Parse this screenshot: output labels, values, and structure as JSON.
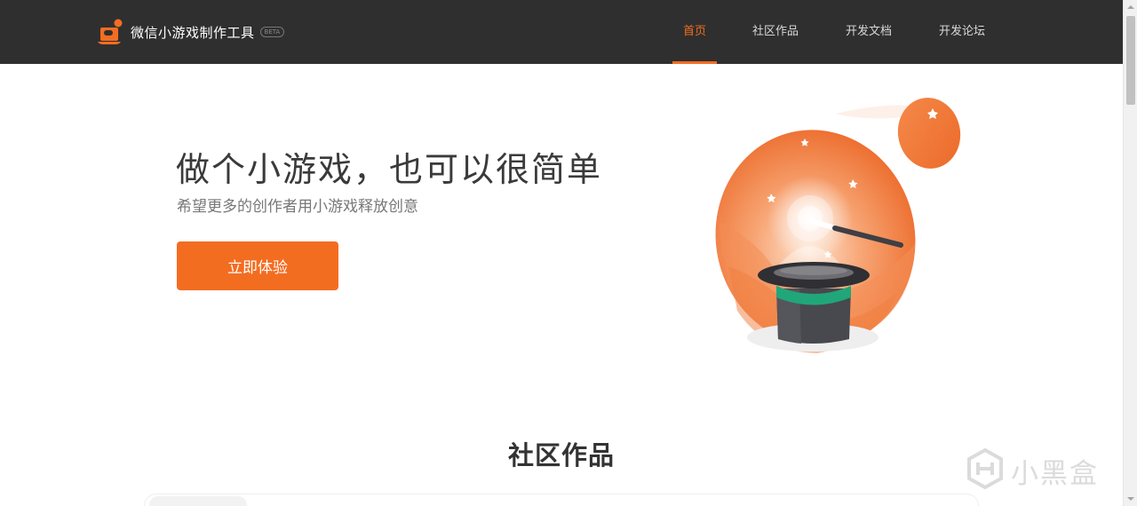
{
  "header": {
    "logo_text": "微信小游戏制作工具",
    "beta_label": "BETA",
    "nav": [
      {
        "label": "首页",
        "active": true
      },
      {
        "label": "社区作品",
        "active": false
      },
      {
        "label": "开发文档",
        "active": false
      },
      {
        "label": "开发论坛",
        "active": false
      }
    ]
  },
  "hero": {
    "title": "做个小游戏，也可以很简单",
    "subtitle": "希望更多的创作者用小游戏释放创意",
    "cta_label": "立即体验",
    "illustration_icon": "magic-hat-icon"
  },
  "community": {
    "section_title": "社区作品"
  },
  "watermark": {
    "text": "小黑盒"
  },
  "colors": {
    "accent": "#f36d21",
    "header_bg": "#2f2f2f",
    "text_dark": "#3a3a3a",
    "text_muted": "#777777"
  }
}
